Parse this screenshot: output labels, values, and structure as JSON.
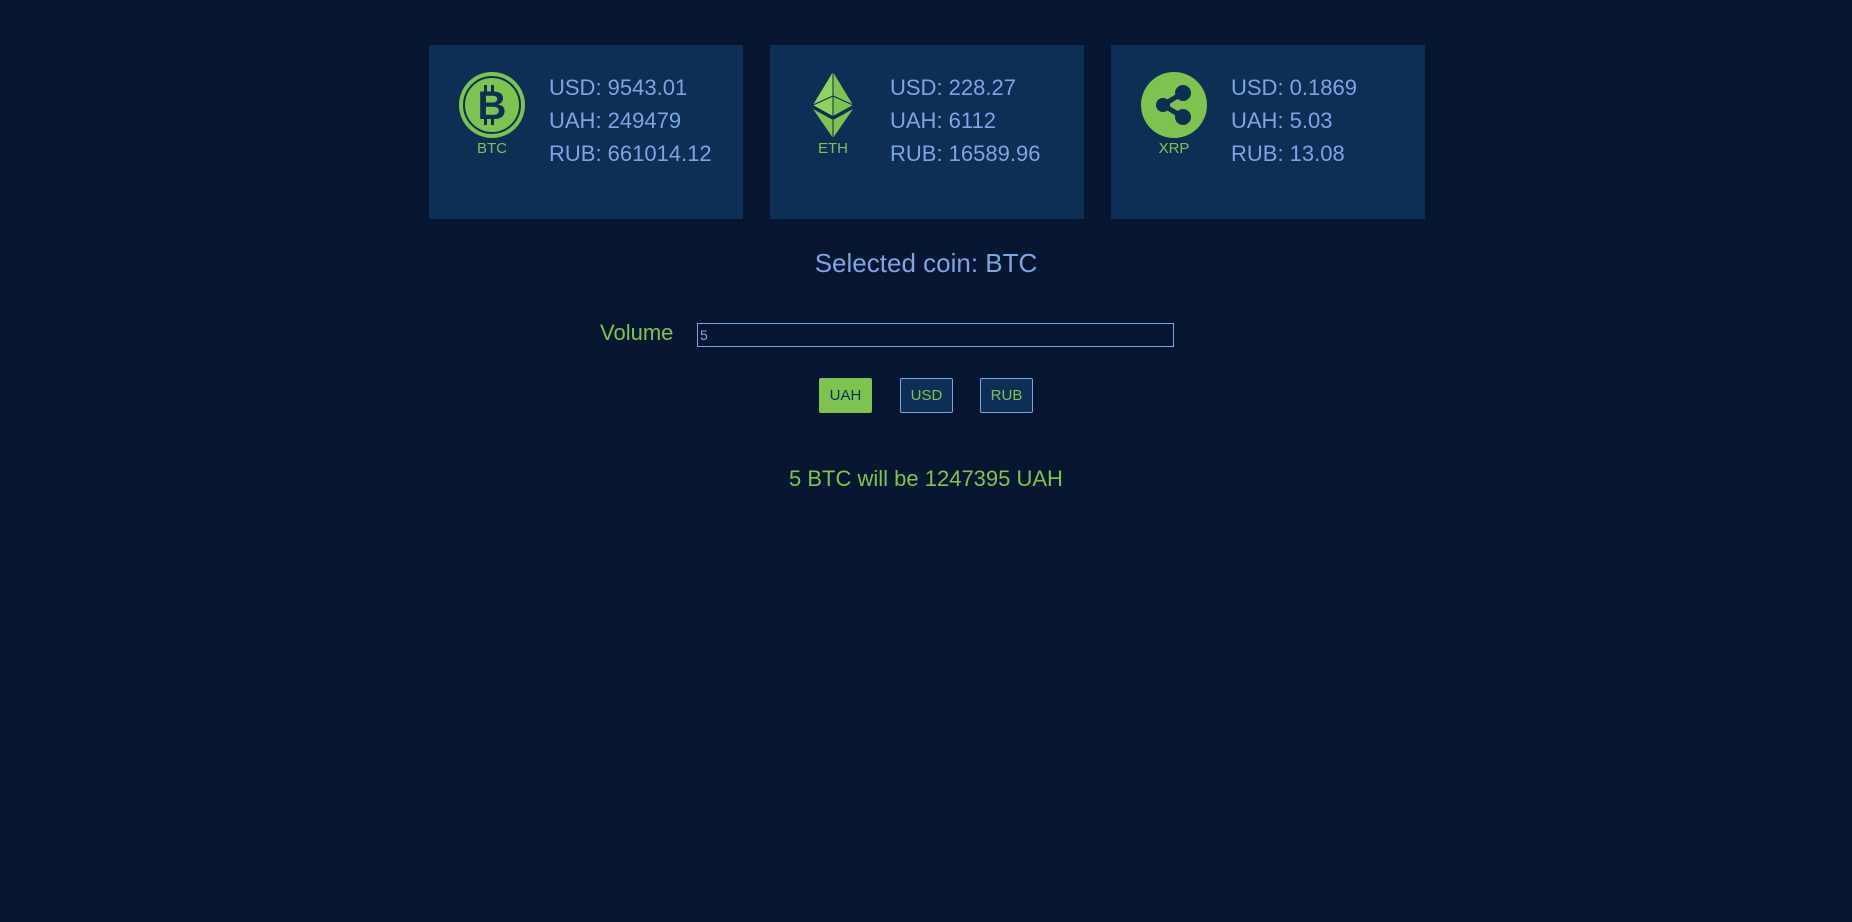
{
  "coins": [
    {
      "symbol": "BTC",
      "icon": "bitcoin-icon",
      "usd": "USD: 9543.01",
      "uah": "UAH: 249479",
      "rub": "RUB: 661014.12"
    },
    {
      "symbol": "ETH",
      "icon": "ethereum-icon",
      "usd": "USD: 228.27",
      "uah": "UAH: 6112",
      "rub": "RUB: 16589.96"
    },
    {
      "symbol": "XRP",
      "icon": "ripple-icon",
      "usd": "USD: 0.1869",
      "uah": "UAH: 5.03",
      "rub": "RUB: 13.08"
    }
  ],
  "selected_text": "Selected coin: BTC",
  "volume": {
    "label": "Volume",
    "value": "5"
  },
  "currency_buttons": [
    {
      "label": "UAH",
      "active": true
    },
    {
      "label": "USD",
      "active": false
    },
    {
      "label": "RUB",
      "active": false
    }
  ],
  "result_text": "5 BTC will be 1247395 UAH",
  "colors": {
    "background": "#061530",
    "card": "#0d2f55",
    "accent_green": "#7ec34f",
    "text_blue": "#7aa6e6"
  }
}
